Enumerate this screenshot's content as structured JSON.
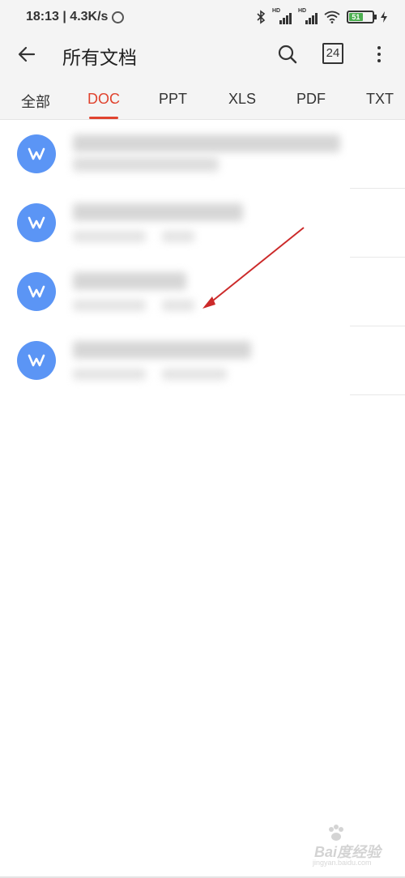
{
  "status_bar": {
    "time_speed": "18:13 | 4.3K/s",
    "network_label_1": "HD",
    "network_label_2": "HD",
    "battery": "51"
  },
  "toolbar": {
    "title": "所有文档",
    "calendar_day": "24",
    "icons": [
      "back-arrow-icon",
      "search-icon",
      "calendar-icon",
      "more-vert-icon"
    ]
  },
  "tabs": [
    {
      "label": "全部",
      "active": false
    },
    {
      "label": "DOC",
      "active": true
    },
    {
      "label": "PPT",
      "active": false
    },
    {
      "label": "XLS",
      "active": false
    },
    {
      "label": "PDF",
      "active": false
    },
    {
      "label": "TXT",
      "active": false
    }
  ],
  "files": [
    {
      "icon": "word-doc-icon"
    },
    {
      "icon": "word-doc-icon"
    },
    {
      "icon": "word-doc-icon"
    },
    {
      "icon": "word-doc-icon"
    }
  ],
  "colors": {
    "accent": "#e0432e",
    "doc_icon": "#5b95f5",
    "annotation_arrow": "#cc2a2a"
  },
  "watermark": {
    "brand": "Bai度经验",
    "url": "jingyan.baidu.com"
  }
}
